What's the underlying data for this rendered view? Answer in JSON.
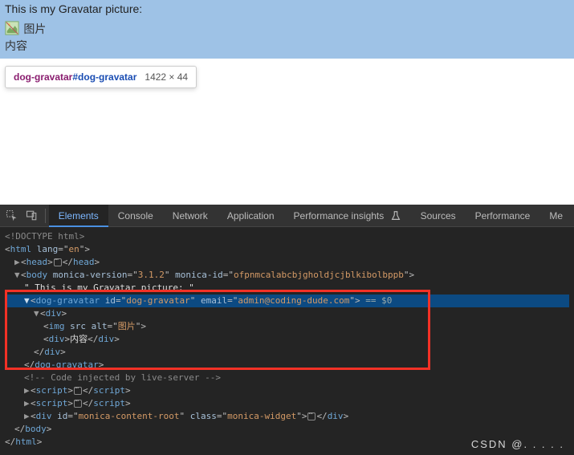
{
  "viewport": {
    "page_text": "This is my Gravatar picture:",
    "broken_img_alt": "图片",
    "content_text": "内容"
  },
  "tooltip": {
    "tag": "dog-gravatar",
    "id": "#dog-gravatar",
    "dims": "1422 × 44"
  },
  "tabs": {
    "elements": "Elements",
    "console": "Console",
    "network": "Network",
    "application": "Application",
    "perf_insights": "Performance insights",
    "sources": "Sources",
    "performance": "Performance",
    "more": "Me"
  },
  "dom": {
    "doctype": "<!DOCTYPE html>",
    "html_open_tag": "html",
    "html_lang_attr": "lang",
    "html_lang_val": "en",
    "head_tag": "head",
    "body_tag": "body",
    "body_attr1": "monica-version",
    "body_val1": "3.1.2",
    "body_attr2": "monica-id",
    "body_val2": "ofpnmcalabcbjgholdjcjblkibolbppb",
    "body_text_quote": "\" This is my Gravatar picture: \"",
    "dg_tag": "dog-gravatar",
    "dg_id_attr": "id",
    "dg_id_val": "dog-gravatar",
    "dg_email_attr": "email",
    "dg_email_val": "admin@coding-dude.com",
    "sel0": "== $0",
    "div_tag": "div",
    "img_tag": "img",
    "img_src_attr": "src",
    "img_alt_attr": "alt",
    "img_alt_val": "图片",
    "inner_text": "内容",
    "comment": "<!-- Code injected by live-server -->",
    "script_tag": "script",
    "mon_div_tag": "div",
    "mon_id_attr": "id",
    "mon_id_val": "monica-content-root",
    "mon_class_attr": "class",
    "mon_class_val": "monica-widget"
  },
  "watermark": "CSDN @.    . . . ."
}
